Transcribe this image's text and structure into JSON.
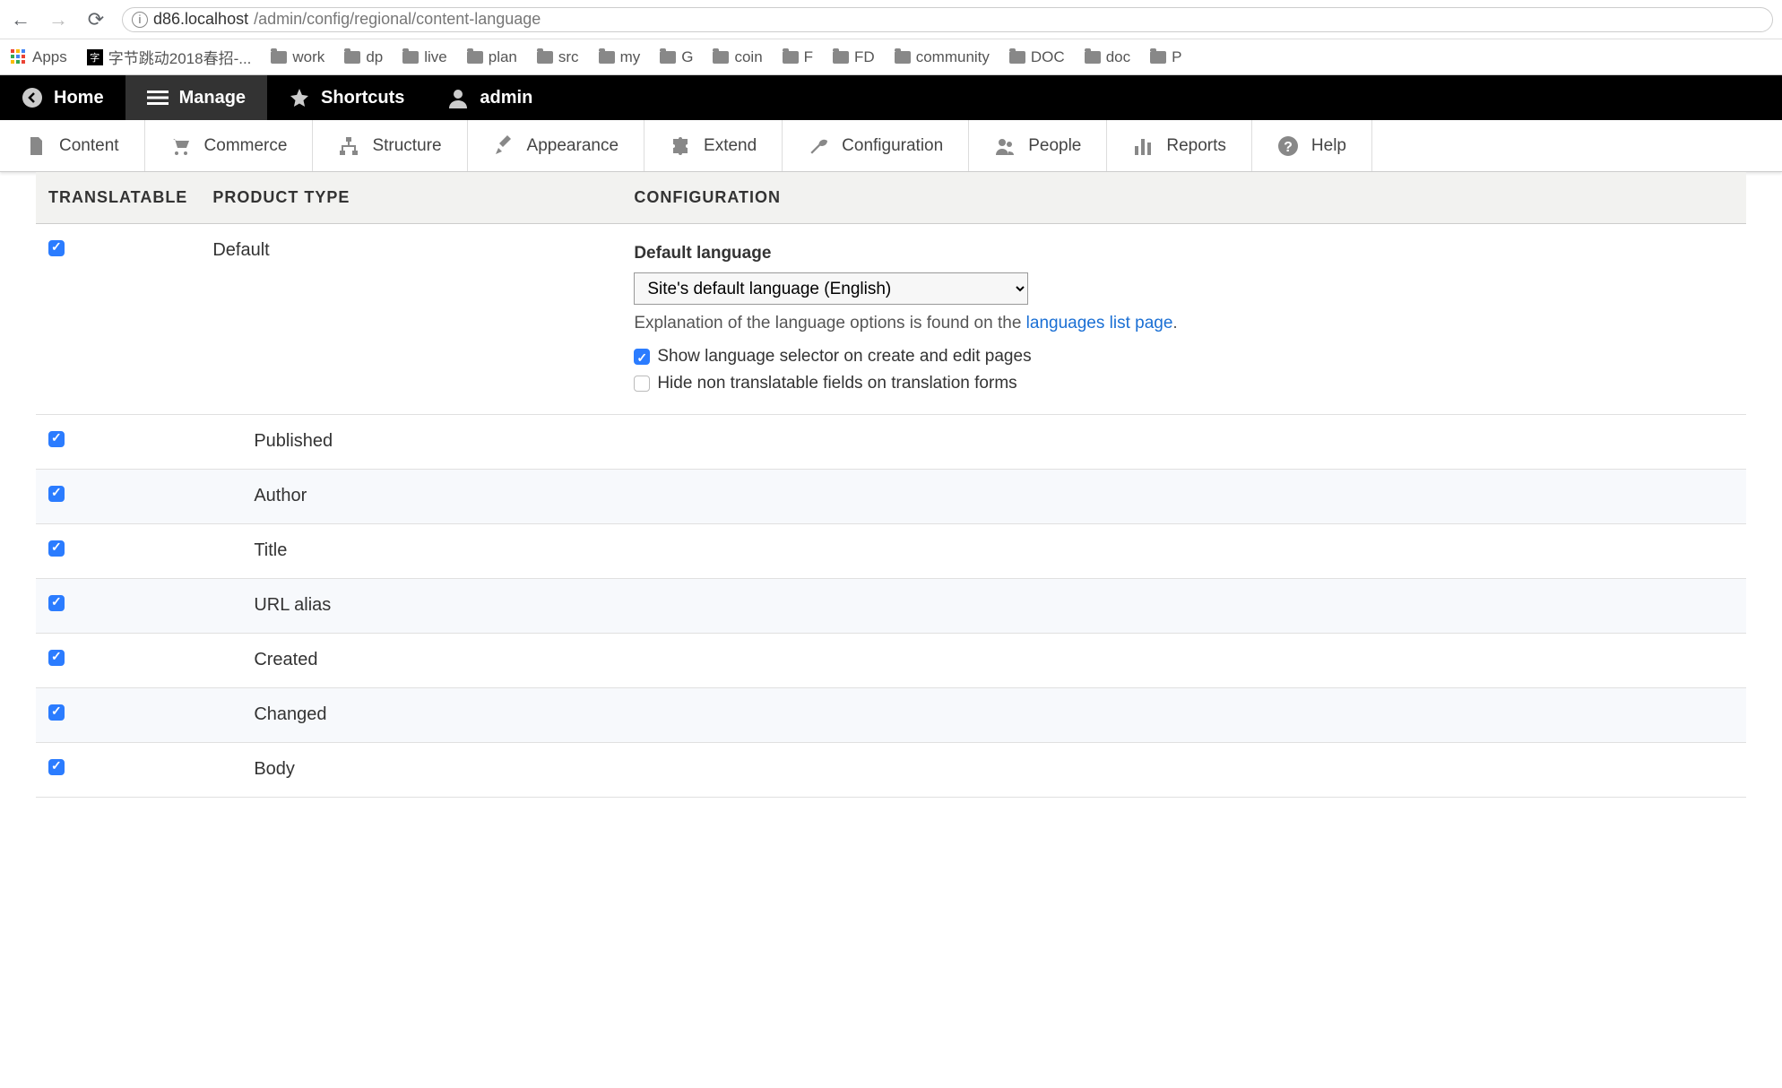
{
  "browser": {
    "url_host": "d86.localhost",
    "url_path": "/admin/config/regional/content-language"
  },
  "bookmarks": {
    "apps": "Apps",
    "byte": "字节跳动2018春招-...",
    "folders": [
      "work",
      "dp",
      "live",
      "plan",
      "src",
      "my",
      "G",
      "coin",
      "F",
      "FD",
      "community",
      "DOC",
      "doc",
      "P"
    ]
  },
  "toolbar": {
    "home": "Home",
    "manage": "Manage",
    "shortcuts": "Shortcuts",
    "admin": "admin"
  },
  "admin_menu": {
    "content": "Content",
    "commerce": "Commerce",
    "structure": "Structure",
    "appearance": "Appearance",
    "extend": "Extend",
    "configuration": "Configuration",
    "people": "People",
    "reports": "Reports",
    "help": "Help"
  },
  "table": {
    "header_translatable": "TRANSLATABLE",
    "header_type": "PRODUCT TYPE",
    "header_config": "CONFIGURATION",
    "default_language_label": "Default language",
    "default_language_value": "Site's default language (English)",
    "help_prefix": "Explanation of the language options is found on the ",
    "help_link": "languages list page",
    "help_suffix": ".",
    "opt_show": "Show language selector on create and edit pages",
    "opt_hide": "Hide non translatable fields on translation forms",
    "rows": [
      {
        "label": "Default"
      },
      {
        "label": "Published"
      },
      {
        "label": "Author"
      },
      {
        "label": "Title"
      },
      {
        "label": "URL alias"
      },
      {
        "label": "Created"
      },
      {
        "label": "Changed"
      },
      {
        "label": "Body"
      }
    ]
  }
}
